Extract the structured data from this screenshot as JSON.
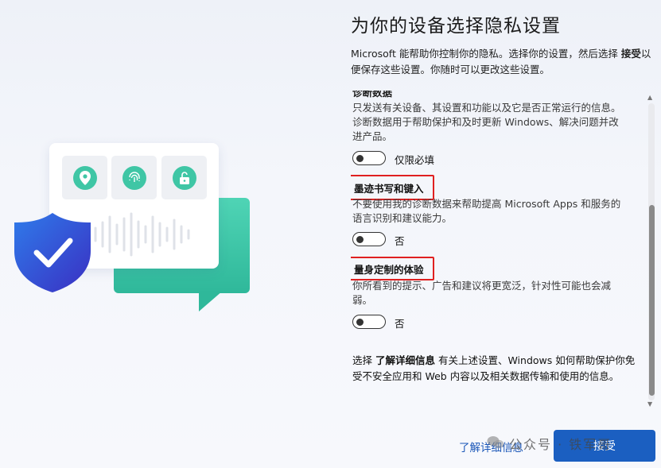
{
  "page": {
    "title": "为你的设备选择隐私设置",
    "intro_pre": "Microsoft 能帮助你控制你的隐私。选择你的设置，然后选择 ",
    "intro_bold": "接受",
    "intro_post": "以便保存这些设置。你随时可以更改这些设置。"
  },
  "sections": [
    {
      "id": "diagnostic",
      "title_clipped": "诊断数据",
      "description": "只发送有关设备、其设置和功能以及它是否正常运行的信息。诊断数据用于帮助保护和及时更新 Windows、解决问题并改进产品。",
      "toggle_label": "仅限必填",
      "toggle_on": false
    },
    {
      "id": "inking",
      "title": "墨迹书写和键入",
      "description": "不要使用我的诊断数据来帮助提高 Microsoft Apps 和服务的语言识别和建议能力。",
      "toggle_label": "否",
      "toggle_on": false,
      "highlighted": true
    },
    {
      "id": "tailored",
      "title": "量身定制的体验",
      "description": "你所看到的提示、广告和建议将更宽泛，针对性可能也会减弱。",
      "toggle_label": "否",
      "toggle_on": false,
      "highlighted": true
    }
  ],
  "footer_note": {
    "pre": "选择 ",
    "bold": "了解详细信息",
    "post": " 有关上述设置、Windows 如何帮助保护你免受不安全应用和 Web 内容以及相关数据传输和使用的信息。"
  },
  "buttons": {
    "learn_more": "了解详细信息",
    "accept": "接受"
  },
  "watermark": "公众号 · 铁军哥",
  "colors": {
    "accent": "#1b5fc1",
    "highlight": "#e02020",
    "teal": "#3fc6a5",
    "shield": "#3b4fd6"
  },
  "icons": [
    "location-pin-icon",
    "fingerprint-icon",
    "unlock-icon",
    "shield-check-icon"
  ]
}
